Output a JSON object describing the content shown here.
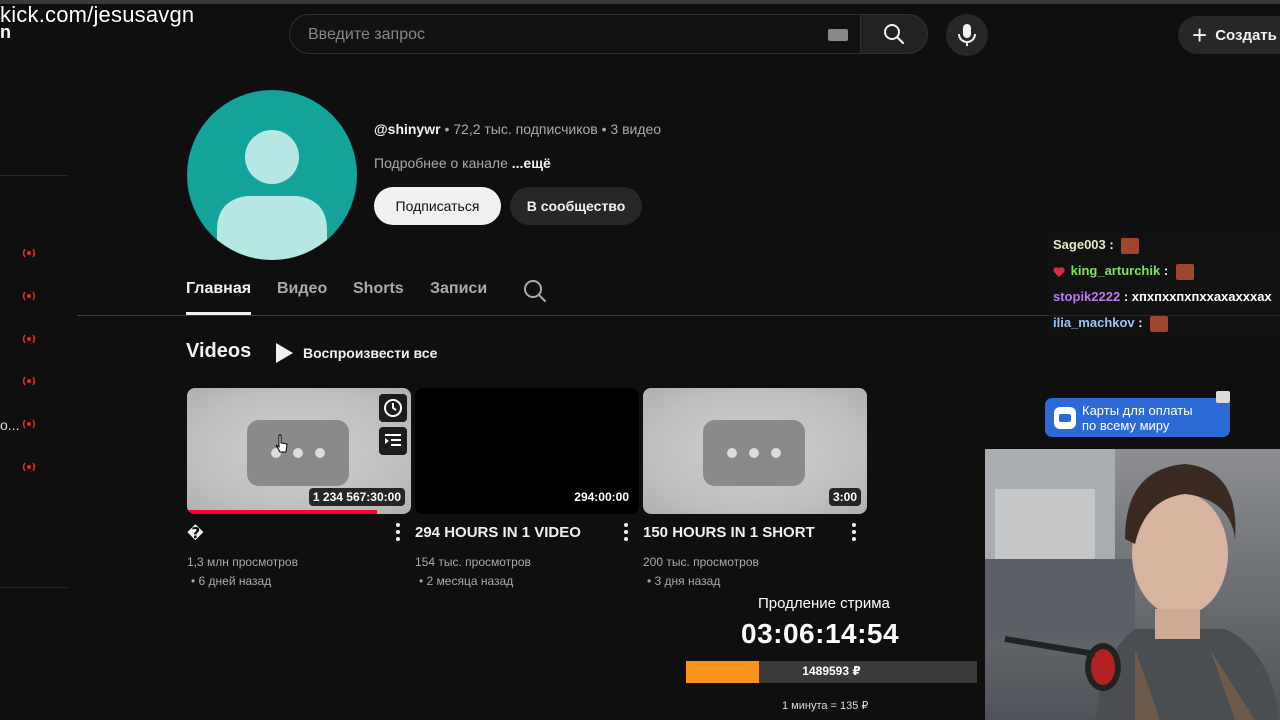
{
  "overlay": {
    "stream_url": "kick.com/jesusavgn",
    "sidebar_char": "n",
    "sidebar_trunc": "o...",
    "chat": [
      {
        "user": "Sage003",
        "sep": ":",
        "message": "",
        "color": "#e6e6c8"
      },
      {
        "user": "king_arturchik",
        "sep": ":",
        "message": "",
        "color": "#7ce35a"
      },
      {
        "user": "stopik2222",
        "sep": ":",
        "message": "хпхпххпхпххахахххах",
        "color": "#b77cf0"
      },
      {
        "user": "ilia_machkov",
        "sep": ":",
        "message": "",
        "color": "#9dc3f5"
      }
    ],
    "ad": {
      "line1": "Карты для оплаты",
      "line2": "по всему миру"
    },
    "extension": {
      "title": "Продление стрима",
      "timer": "03:06:14:54",
      "amount": "1489593 ₽",
      "progress": 0.25,
      "rate": "1 минута = 135 ₽"
    }
  },
  "header": {
    "search_placeholder": "Введите запрос",
    "create_label": "Создать"
  },
  "channel": {
    "handle": "@shinywr",
    "stats": " • 72,2 тыс. подписчиков • 3 видео",
    "about": "Подробнее о канале ",
    "more": "...ещё",
    "subscribe": "Подписаться",
    "community": "В сообщество"
  },
  "tabs": [
    "Главная",
    "Видео",
    "Shorts",
    "Записи"
  ],
  "section": {
    "title": "Videos",
    "play_all": "Воспроизвести все"
  },
  "videos": [
    {
      "title": "�",
      "duration": "1 234 567:30:00",
      "views": "1,3 млн просмотров",
      "age": "• 6 дней назад",
      "watched": 0.85
    },
    {
      "title": "294 HOURS IN 1 VIDEO",
      "duration": "294:00:00",
      "views": "154 тыс. просмотров",
      "age": "• 2 месяца назад"
    },
    {
      "title": "150 HOURS IN 1 SHORT",
      "duration": "3:00",
      "views": "200 тыс. просмотров",
      "age": "• 3 дня назад"
    }
  ],
  "colors": {
    "accent": "#ff0033",
    "avatar": "#13a39a",
    "extension_bar": "#f7931e",
    "ad": "#2c6ad8"
  }
}
